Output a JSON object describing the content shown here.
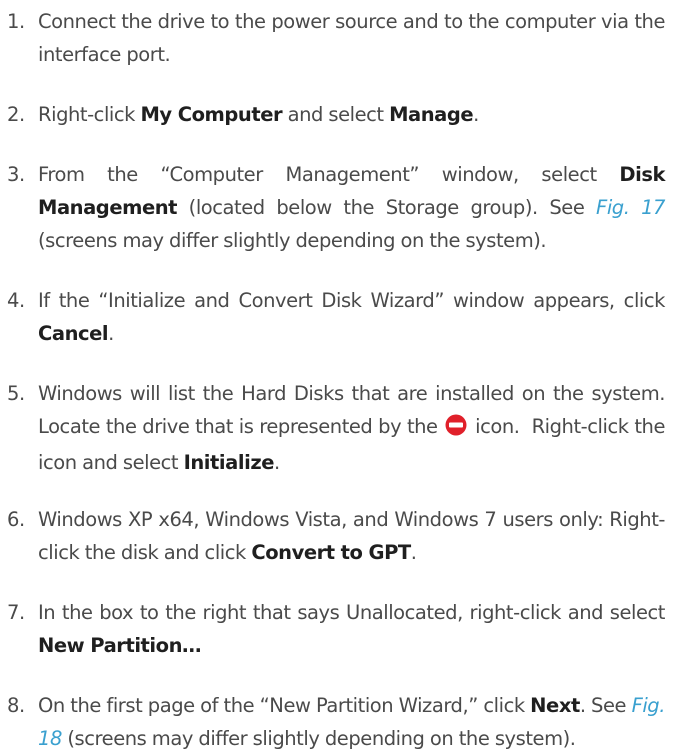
{
  "steps": [
    {
      "number": "1.",
      "parts": [
        "Connect the drive to the power source and to the computer via the interface port."
      ]
    },
    {
      "number": "2.",
      "parts": [
        "Right-click ",
        "My Computer",
        " and select ",
        "Manage",
        "."
      ]
    },
    {
      "number": "3.",
      "parts": [
        "From the “Computer Management” window, select ",
        "Disk Management",
        " (located below the Storage group). See ",
        "Fig. 17",
        " (screens may differ slightly depending on the system)."
      ]
    },
    {
      "number": "4.",
      "parts": [
        "If the “Initialize and Convert Disk Wizard” window appears, click ",
        "Cancel",
        "."
      ]
    },
    {
      "number": "5.",
      "parts": [
        "Windows will list the Hard Disks that are installed on the system. Locate the drive that is represented by the ",
        " icon.",
        "Right-click the icon and select ",
        "Initialize",
        "."
      ],
      "icon": "uninitialized-disk-icon",
      "icon_color": "#e0202a"
    },
    {
      "number": "6.",
      "parts": [
        "Windows XP x64, Windows Vista, and Windows 7 users only: Right-click the disk and click ",
        "Convert to GPT",
        "."
      ]
    },
    {
      "number": "7.",
      "parts": [
        "In the box to the right that says Unallocated, right-click and select ",
        "New Partition…"
      ]
    },
    {
      "number": "8.",
      "parts": [
        "On the first page of the “New Partition Wizard,” click ",
        "Next",
        ". See ",
        "Fig. 18",
        " (screens may differ slightly depending on the system)."
      ]
    }
  ],
  "colors": {
    "text": "#4a4a4a",
    "bold": "#1f1f1f",
    "link": "#3aa0cf"
  }
}
